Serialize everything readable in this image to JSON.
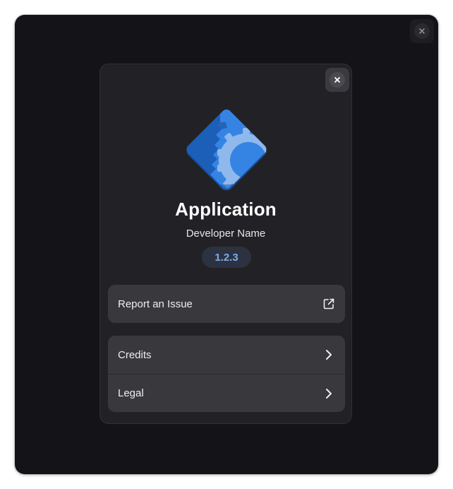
{
  "app": {
    "name": "Application",
    "developer": "Developer Name",
    "version": "1.2.3"
  },
  "links": {
    "report_issue": "Report an Issue"
  },
  "menu": {
    "items": [
      {
        "label": "Credits"
      },
      {
        "label": "Legal"
      }
    ]
  },
  "colors": {
    "window_bg": "#131318",
    "dialog_bg": "#222226",
    "card_bg": "#38383d",
    "accent": "#78aeed",
    "icon_blue": "#3584e4"
  },
  "icons": {
    "outer_close": "close-icon",
    "dialog_close": "close-icon",
    "app": "app-gear-icon",
    "report_issue": "external-link-icon",
    "credits": "chevron-right-icon",
    "legal": "chevron-right-icon"
  }
}
